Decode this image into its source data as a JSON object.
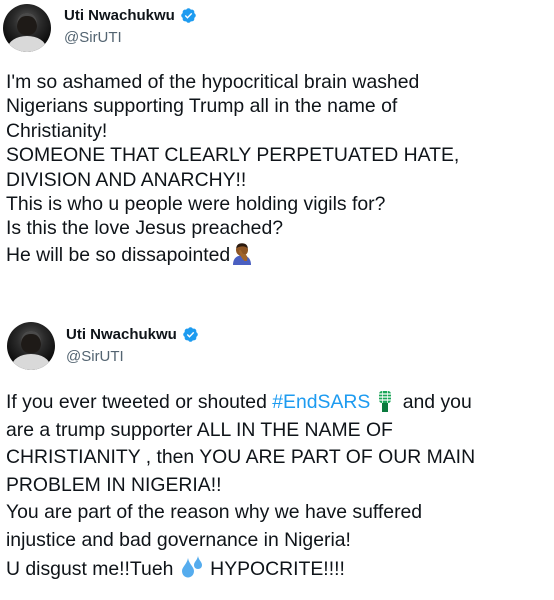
{
  "tweets": [
    {
      "author": {
        "display_name": "Uti Nwachukwu",
        "handle": "@SirUTI",
        "verified": true
      },
      "text_lines": [
        "I'm so ashamed of the hypocritical brain washed",
        "Nigerians supporting Trump all in the name of",
        "Christianity!",
        "SOMEONE THAT CLEARLY PERPETUATED HATE,",
        "DIVISION AND ANARCHY!!",
        "This is who u people were holding vigils for?",
        "Is this the love Jesus preached?",
        "He will be so dissapointed"
      ],
      "trailing_emoji": "person-facepalming-emoji"
    },
    {
      "author": {
        "display_name": "Uti Nwachukwu",
        "handle": "@SirUTI",
        "verified": true
      },
      "text": {
        "l1_pre": "If you ever tweeted or shouted ",
        "l1_hashtag": "#EndSARS",
        "l1_post": " and you",
        "l2": "are a trump supporter ALL IN THE NAME OF",
        "l3": "CHRISTIANITY , then YOU ARE PART OF OUR MAIN",
        "l4": "PROBLEM IN NIGERIA!!",
        "l5": "You are part of the reason why we have suffered",
        "l6": "injustice and bad governance in Nigeria!",
        "l7_pre": "U disgust me!!Tueh ",
        "l7_post": " HYPOCRITE!!!!"
      },
      "emojis": [
        "raised-fist-emoji",
        "sweat-droplets-emoji"
      ]
    }
  ],
  "colors": {
    "text": "#0f1419",
    "secondary": "#536471",
    "link": "#1d9bf0",
    "verified": "#1d9bf0"
  }
}
